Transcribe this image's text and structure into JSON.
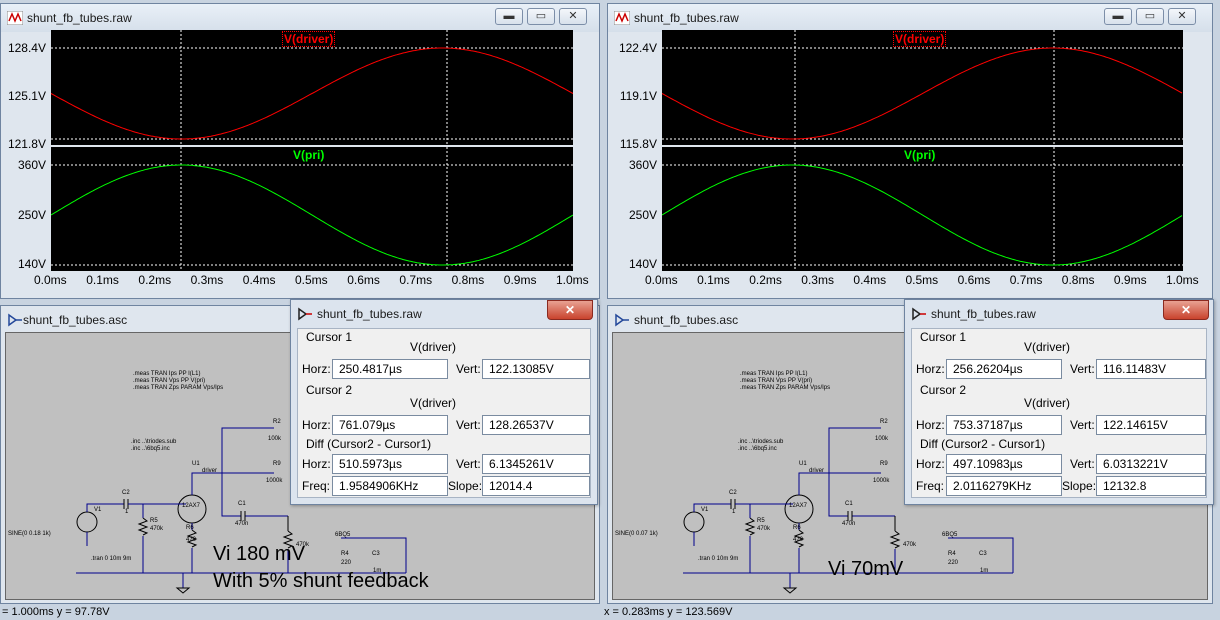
{
  "left": {
    "waveform_window": {
      "title": "shunt_fb_tubes.raw",
      "pane1": {
        "trace": "V(driver)",
        "y_ticks": [
          "128.4V",
          "125.1V",
          "121.8V"
        ],
        "color": "#ff0000"
      },
      "pane2": {
        "trace": "V(pri)",
        "y_ticks": [
          "360V",
          "250V",
          "140V"
        ],
        "color": "#00ff00"
      },
      "x_ticks": [
        "0.0ms",
        "0.1ms",
        "0.2ms",
        "0.3ms",
        "0.4ms",
        "0.5ms",
        "0.6ms",
        "0.7ms",
        "0.8ms",
        "0.9ms",
        "1.0ms"
      ]
    },
    "schematic_window": {
      "title": "shunt_fb_tubes.asc",
      "meas": [
        ".meas TRAN Ips PP I(L1)",
        ".meas TRAN Vps PP V(pri)",
        ".meas TRAN Zps PARAM Vps/Ips"
      ],
      "inc": [
        ".inc ..\\triodes.sub",
        ".inc ..\\6bq5.inc"
      ],
      "source": "SINE(0 0.18 1k)",
      "tran": ".tran 0 10m 9m",
      "components": {
        "v1": "V1",
        "c2": "C2",
        "c2_val": "1",
        "r5": "R5",
        "r5_val": "470k",
        "u1": "U1",
        "u1_val": "12AX7",
        "r6": "R6",
        "r6_val": "470",
        "c1": "C1",
        "c1_val": "470n",
        "r2": "R2",
        "r2_val": "100k",
        "r9": "R9",
        "r9_val": "1000k",
        "driver": "driver",
        "r3_val": "470k",
        "r4": "R4",
        "r4_val": "220",
        "c3": "C3",
        "c3_val": "1m",
        "tube2": "6BQ5"
      },
      "caption_line1": "Vi 180 mV",
      "caption_line2": "With 5% shunt feedback"
    },
    "cursor_dialog": {
      "title": "shunt_fb_tubes.raw",
      "close": "✕",
      "cursor1": {
        "group": "Cursor 1",
        "trace": "V(driver)",
        "horz_label": "Horz:",
        "horz": "250.4817µs",
        "vert_label": "Vert:",
        "vert": "122.13085V"
      },
      "cursor2": {
        "group": "Cursor 2",
        "trace": "V(driver)",
        "horz_label": "Horz:",
        "horz": "761.079µs",
        "vert_label": "Vert:",
        "vert": "128.26537V"
      },
      "diff": {
        "group": "Diff (Cursor2 - Cursor1)",
        "horz_label": "Horz:",
        "horz": "510.5973µs",
        "vert_label": "Vert:",
        "vert": "6.1345261V",
        "freq_label": "Freq:",
        "freq": "1.9584906KHz",
        "slope_label": "Slope:",
        "slope": "12014.4"
      }
    },
    "status": "= 1.000ms    y = 97.78V"
  },
  "right": {
    "waveform_window": {
      "title": "shunt_fb_tubes.raw",
      "pane1": {
        "trace": "V(driver)",
        "y_ticks": [
          "122.4V",
          "119.1V",
          "115.8V"
        ],
        "color": "#ff0000"
      },
      "pane2": {
        "trace": "V(pri)",
        "y_ticks": [
          "360V",
          "250V",
          "140V"
        ],
        "color": "#00ff00"
      },
      "x_ticks": [
        "0.0ms",
        "0.1ms",
        "0.2ms",
        "0.3ms",
        "0.4ms",
        "0.5ms",
        "0.6ms",
        "0.7ms",
        "0.8ms",
        "0.9ms",
        "1.0ms"
      ]
    },
    "schematic_window": {
      "title": "shunt_fb_tubes.asc",
      "meas": [
        ".meas TRAN Ips PP I(L1)",
        ".meas TRAN Vps PP V(pri)",
        ".meas TRAN Zps PARAM Vps/Ips"
      ],
      "inc": [
        ".inc ..\\triodes.sub",
        ".inc ..\\6bq5.inc"
      ],
      "source": "SINE(0 0.07 1k)",
      "tran": ".tran 0 10m 9m",
      "components": {
        "v1": "V1",
        "c2": "C2",
        "c2_val": "1",
        "r5": "R5",
        "r5_val": "470k",
        "u1": "U1",
        "u1_val": "12AX7",
        "r6": "R6",
        "r6_val": "470",
        "c1": "C1",
        "c1_val": "470n",
        "r2": "R2",
        "r2_val": "100k",
        "r9": "R9",
        "r9_val": "1000k",
        "driver": "driver",
        "r3_val": "470k",
        "r4": "R4",
        "r4_val": "220",
        "c3": "C3",
        "c3_val": "1m",
        "tube2": "6BQ5"
      },
      "caption_line1": "Vi 70mV",
      "caption_line2": ""
    },
    "cursor_dialog": {
      "title": "shunt_fb_tubes.raw",
      "close": "✕",
      "cursor1": {
        "group": "Cursor 1",
        "trace": "V(driver)",
        "horz_label": "Horz:",
        "horz": "256.26204µs",
        "vert_label": "Vert:",
        "vert": "116.11483V"
      },
      "cursor2": {
        "group": "Cursor 2",
        "trace": "V(driver)",
        "horz_label": "Horz:",
        "horz": "753.37187µs",
        "vert_label": "Vert:",
        "vert": "122.14615V"
      },
      "diff": {
        "group": "Diff (Cursor2 - Cursor1)",
        "horz_label": "Horz:",
        "horz": "497.10983µs",
        "vert_label": "Vert:",
        "vert": "6.0313221V",
        "freq_label": "Freq:",
        "freq": "2.0116279KHz",
        "slope_label": "Slope:",
        "slope": "12132.8"
      }
    },
    "status": "x = 0.283ms    y = 123.569V"
  },
  "window_buttons": {
    "minimize": "▬",
    "restore": "▭",
    "close": "✕"
  }
}
